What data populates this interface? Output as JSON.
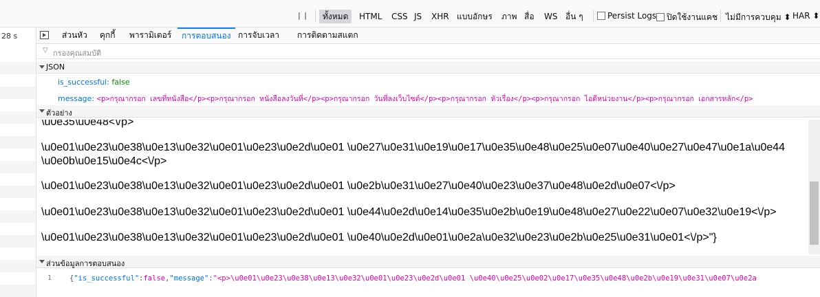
{
  "toolbar": {
    "pause": "| |",
    "filters": [
      "ทั้งหมด",
      "HTML",
      "CSS",
      "JS",
      "XHR",
      "แบบอักษร",
      "ภาพ",
      "สื่อ",
      "WS",
      "อื่น ๆ"
    ],
    "persist_logs": "Persist Logs",
    "disable_cache": "ปิดใช้งานแคช",
    "throttling": "ไม่มีการควบคุม ⬍",
    "har": "HAR ⬍"
  },
  "left": {
    "time": "28 s"
  },
  "tabs": [
    "ส่วนหัว",
    "คุกกี้",
    "พารามิเตอร์",
    "การตอบสนอง",
    "การจับเวลา",
    "การติดตามสแตก"
  ],
  "filter_placeholder": "กรองคุณสมบัติ",
  "json_section": {
    "title": "JSON",
    "is_successful_key": "is_successful:",
    "is_successful_value": "false",
    "message_key": "message:",
    "message_value": "<p>กรุณากรอก เลขที่หนังสือ</p><p>กรุณากรอก หนังสือลงวันที่</p><p>กรุณากรอก วันที่ลงเว็บไซต์</p><p>กรุณากรอก หัวเรื่อง</p><p>กรุณากรอก ไอดีหน่วยงาน</p><p>กรุณากรอก เอกสารหลัก</p>"
  },
  "preview_section": {
    "title": "ตัวอย่าง",
    "lines": [
      "\\u0e35\\u0e48<\\/p>",
      "\\u0e01\\u0e23\\u0e38\\u0e13\\u0e32\\u0e01\\u0e23\\u0e2d\\u0e01 \\u0e27\\u0e31\\u0e19\\u0e17\\u0e35\\u0e48\\u0e25\\u0e07\\u0e40\\u0e27\\u0e47\\u0e1a\\u0e44",
      "\\u0e0b\\u0e15\\u0e4c<\\/p>",
      "\\u0e01\\u0e23\\u0e38\\u0e13\\u0e32\\u0e01\\u0e23\\u0e2d\\u0e01 \\u0e2b\\u0e31\\u0e27\\u0e40\\u0e23\\u0e37\\u0e48\\u0e2d\\u0e07<\\/p>",
      "\\u0e01\\u0e23\\u0e38\\u0e13\\u0e32\\u0e01\\u0e23\\u0e2d\\u0e01 \\u0e44\\u0e2d\\u0e14\\u0e35\\u0e2b\\u0e19\\u0e48\\u0e27\\u0e22\\u0e07\\u0e32\\u0e19<\\/p>",
      "\\u0e01\\u0e23\\u0e38\\u0e13\\u0e32\\u0e01\\u0e23\\u0e2d\\u0e01 \\u0e40\\u0e2d\\u0e01\\u0e2a\\u0e32\\u0e23\\u0e2b\\u0e25\\u0e31\\u0e01<\\/p>\"}"
    ]
  },
  "payload_section": {
    "title": "ส่วนข้อมูลการตอบสนอง",
    "line_number": "1",
    "code_open": "{",
    "code_k1": "\"is_successful\"",
    "code_colon1": ":",
    "code_v1": "false",
    "code_comma": ",",
    "code_k2": "\"message\"",
    "code_colon2": ":",
    "code_v2": "\"<p>\\u0e01\\u0e23\\u0e38\\u0e13\\u0e32\\u0e01\\u0e23\\u0e2d\\u0e01 \\u0e40\\u0e25\\u0e02\\u0e17\\u0e35\\u0e48\\u0e2b\\u0e19\\u0e31\\u0e07\\u0e2a"
  }
}
